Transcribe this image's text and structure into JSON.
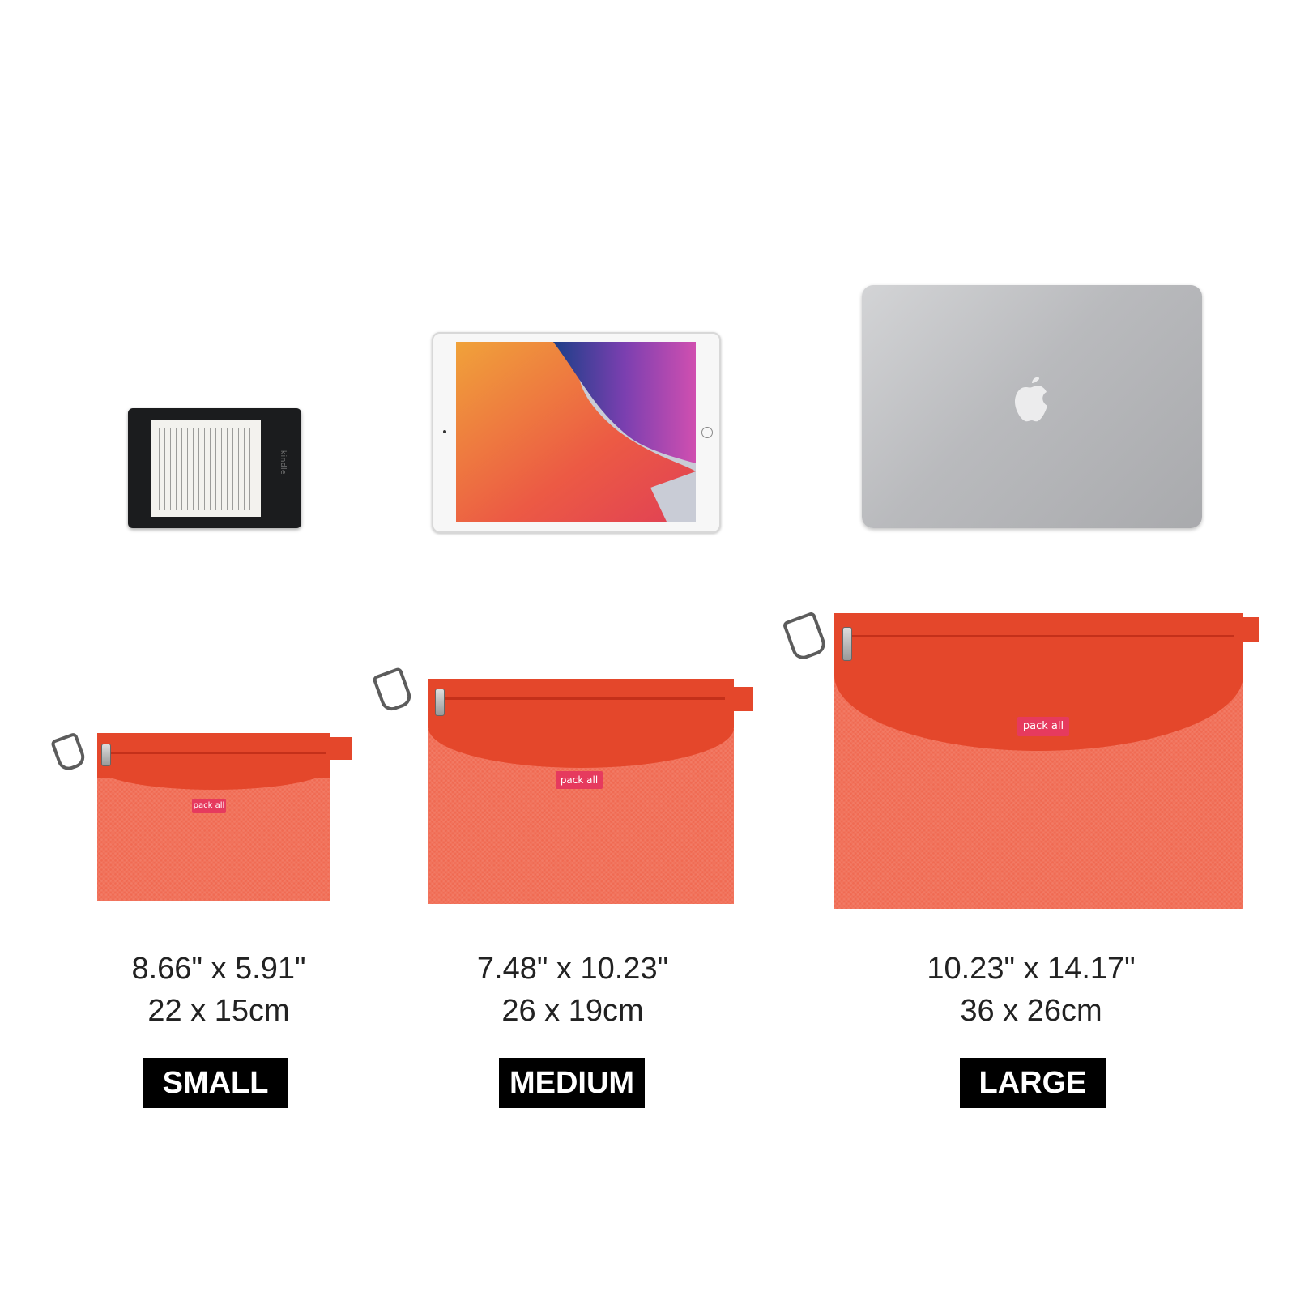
{
  "devices": {
    "kindle": {
      "brand": "kindle"
    },
    "ipad": {},
    "macbook": {}
  },
  "pouches": [
    {
      "size_label": "SMALL",
      "inches": "8.66\" x 5.91\"",
      "cm": "22 x 15cm",
      "brand": "pack all"
    },
    {
      "size_label": "MEDIUM",
      "inches": "7.48\" x 10.23\"",
      "cm": "26 x 19cm",
      "brand": "pack all"
    },
    {
      "size_label": "LARGE",
      "inches": "10.23\" x 14.17\"",
      "cm": "36 x 26cm",
      "brand": "pack all"
    }
  ],
  "colors": {
    "pouch_orange": "#e4472b",
    "mesh_orange": "#f06a52",
    "brand_tag": "#e63a5e",
    "label_bg": "#000000"
  }
}
